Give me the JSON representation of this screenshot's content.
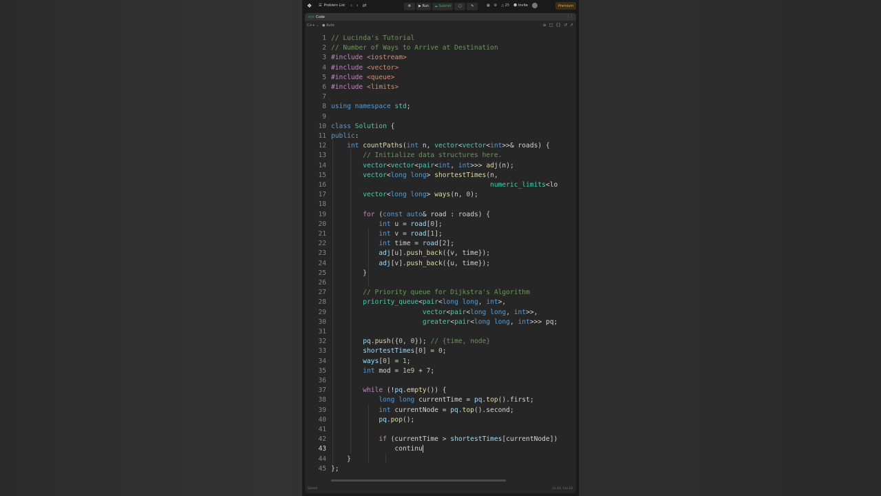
{
  "topbar": {
    "problem_list": "Problem List",
    "run": "Run",
    "submit": "Submit",
    "streak": "25",
    "invite": "Invite",
    "premium": "Premium"
  },
  "panel": {
    "tab_label": "Code",
    "language": "C++",
    "autosave": "Auto"
  },
  "status": {
    "left": "Saved",
    "right": "Ln 43, Col 18"
  },
  "code_lines": [
    {
      "n": "1",
      "t": "// Lucinda's Tutorial"
    },
    {
      "n": "2",
      "t": "// Number of Ways to Arrive at Destination"
    },
    {
      "n": "3",
      "t": "#include <iostream>"
    },
    {
      "n": "4",
      "t": "#include <vector>"
    },
    {
      "n": "5",
      "t": "#include <queue>"
    },
    {
      "n": "6",
      "t": "#include <limits>"
    },
    {
      "n": "7",
      "t": ""
    },
    {
      "n": "8",
      "t": "using namespace std;"
    },
    {
      "n": "9",
      "t": ""
    },
    {
      "n": "10",
      "t": "class Solution {"
    },
    {
      "n": "11",
      "t": "public:"
    },
    {
      "n": "12",
      "t": "    int countPaths(int n, vector<vector<int>>& roads) {"
    },
    {
      "n": "13",
      "t": "        // Initialize data structures here."
    },
    {
      "n": "14",
      "t": "        vector<vector<pair<int, int>>> adj(n);"
    },
    {
      "n": "15",
      "t": "        vector<long long> shortestTimes(n,"
    },
    {
      "n": "16",
      "t": "                                        numeric_limits<lo"
    },
    {
      "n": "17",
      "t": "        vector<long long> ways(n, 0);"
    },
    {
      "n": "18",
      "t": ""
    },
    {
      "n": "19",
      "t": "        for (const auto& road : roads) {"
    },
    {
      "n": "20",
      "t": "            int u = road[0];"
    },
    {
      "n": "21",
      "t": "            int v = road[1];"
    },
    {
      "n": "22",
      "t": "            int time = road[2];"
    },
    {
      "n": "23",
      "t": "            adj[u].push_back({v, time});"
    },
    {
      "n": "24",
      "t": "            adj[v].push_back({u, time});"
    },
    {
      "n": "25",
      "t": "        }"
    },
    {
      "n": "26",
      "t": ""
    },
    {
      "n": "27",
      "t": "        // Priority queue for Dijkstra's Algorithm"
    },
    {
      "n": "28",
      "t": "        priority_queue<pair<long long, int>,"
    },
    {
      "n": "29",
      "t": "                       vector<pair<long long, int>>,"
    },
    {
      "n": "30",
      "t": "                       greater<pair<long long, int>>> pq;"
    },
    {
      "n": "31",
      "t": ""
    },
    {
      "n": "32",
      "t": "        pq.push({0, 0}); // {time, node}"
    },
    {
      "n": "33",
      "t": "        shortestTimes[0] = 0;"
    },
    {
      "n": "34",
      "t": "        ways[0] = 1;"
    },
    {
      "n": "35",
      "t": "        int mod = 1e9 + 7;"
    },
    {
      "n": "36",
      "t": ""
    },
    {
      "n": "37",
      "t": "        while (!pq.empty()) {"
    },
    {
      "n": "38",
      "t": "            long long currentTime = pq.top().first;"
    },
    {
      "n": "39",
      "t": "            int currentNode = pq.top().second;"
    },
    {
      "n": "40",
      "t": "            pq.pop();"
    },
    {
      "n": "41",
      "t": ""
    },
    {
      "n": "42",
      "t": "            if (currentTime > shortestTimes[currentNode])"
    },
    {
      "n": "43",
      "t": "                continu"
    },
    {
      "n": "44",
      "t": "    }"
    },
    {
      "n": "45",
      "t": "};"
    }
  ],
  "current_line": "43",
  "colors": {
    "keyword": "#569cd6",
    "comment": "#6a9955",
    "type": "#4ec9b0",
    "function": "#dcdcaa",
    "preproc": "#c586c0",
    "string": "#ce9178",
    "number": "#b5cea8",
    "accent_green": "#2cbb5d",
    "premium": "#ffa116"
  }
}
